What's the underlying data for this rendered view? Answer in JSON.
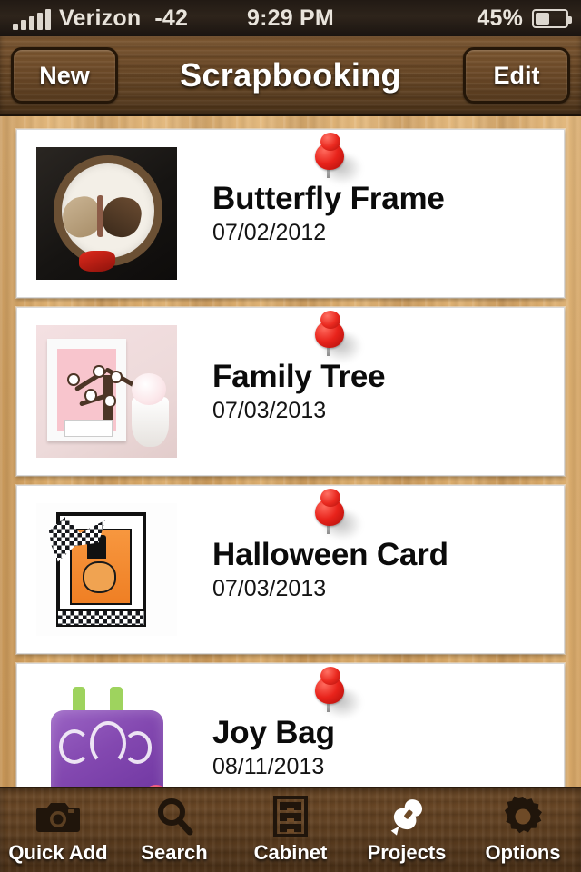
{
  "statusbar": {
    "carrier": "Verizon",
    "signal_value": "-42",
    "time": "9:29 PM",
    "battery_percent": "45%",
    "signal_bars": 5
  },
  "navbar": {
    "title": "Scrapbooking",
    "left_button": "New",
    "right_button": "Edit"
  },
  "projects": [
    {
      "title": "Butterfly Frame",
      "date": "07/02/2012",
      "thumb": "butterfly-frame-photo"
    },
    {
      "title": "Family Tree",
      "date": "07/03/2013",
      "thumb": "family-tree-photo"
    },
    {
      "title": "Halloween Card",
      "date": "07/03/2013",
      "thumb": "halloween-card-photo"
    },
    {
      "title": "Joy Bag",
      "date": "08/11/2013",
      "thumb": "joy-bag-photo"
    }
  ],
  "tabbar": {
    "items": [
      {
        "label": "Quick Add",
        "icon": "camera-icon",
        "active": false
      },
      {
        "label": "Search",
        "icon": "search-icon",
        "active": false
      },
      {
        "label": "Cabinet",
        "icon": "cabinet-icon",
        "active": false
      },
      {
        "label": "Projects",
        "icon": "pushpin-icon",
        "active": true
      },
      {
        "label": "Options",
        "icon": "gear-icon",
        "active": false
      }
    ]
  },
  "colors": {
    "pin_red": "#e8231b",
    "nav_wood": "#6d4a27",
    "board_wood": "#d9a968",
    "active_tab": "#ffffff"
  }
}
